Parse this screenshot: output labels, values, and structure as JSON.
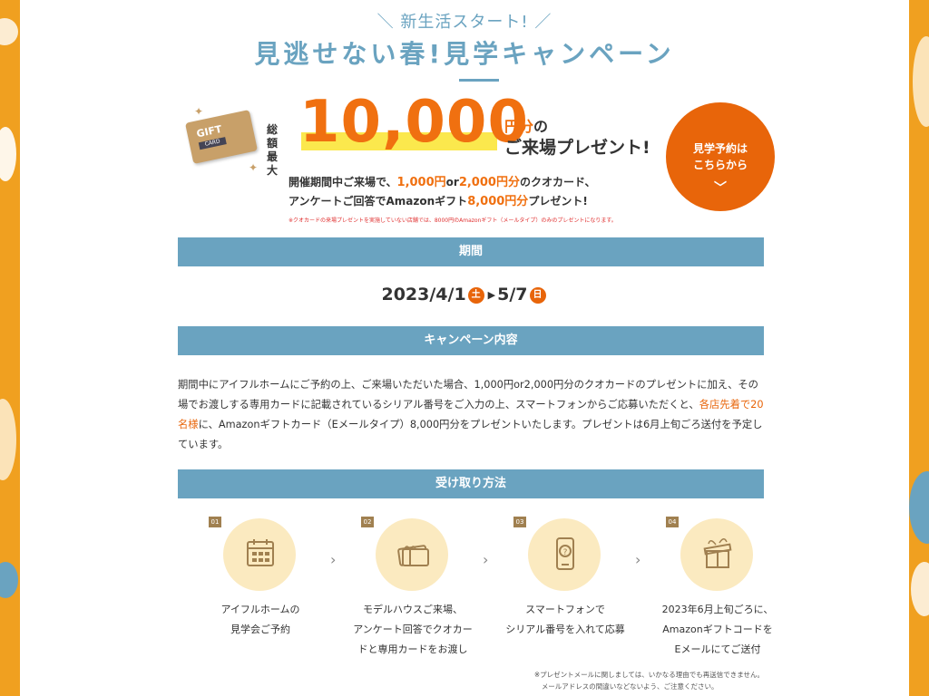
{
  "header": {
    "kicker": "＼ 新生活スタート! ／",
    "title": "見逃せない春!見学キャンペーン"
  },
  "gift_card": {
    "line1": "GIFT",
    "line2": "CARD"
  },
  "offer": {
    "total_label": "総額最大",
    "amount": "10,000",
    "yen_unit": "円分",
    "yen_suffix": "の",
    "present_text": "ご来場プレゼント!",
    "sub1_a": "開催期間中ご来場で、",
    "sub1_b": "1,000円",
    "sub1_c": "or",
    "sub1_d": "2,000円分",
    "sub1_e": "のクオカード、",
    "sub2_a": "アンケートご回答でAmazonギフト",
    "sub2_b": "8,000円分",
    "sub2_c": "プレゼント!",
    "note": "※クオカードの来場プレゼントを実施していない店舗では、8000円のAmazonギフト（メールタイプ）のみのプレゼントになります。"
  },
  "cta": {
    "line1": "見学予約は",
    "line2": "こちらから",
    "chevron": "﹀"
  },
  "period": {
    "heading": "期間",
    "start": "2023/4/1",
    "start_day": "土",
    "arrow": "▶",
    "end": "5/7",
    "end_day": "日"
  },
  "campaign": {
    "heading": "キャンペーン内容",
    "text_a": "期間中にアイフルホームにご予約の上、ご来場いただいた場合、1,000円or2,000円分のクオカードのプレゼントに加え、その場でお渡しする専用カードに記載されているシリアル番号をご入力の上、スマートフォンからご応募いただくと、",
    "text_b": "各店先着で20名様",
    "text_c": "に、Amazonギフトカード（Eメールタイプ）8,000円分をプレゼントいたします。プレゼントは6月上旬ごろ送付を予定しています。"
  },
  "receive": {
    "heading": "受け取り方法",
    "steps": [
      {
        "num": "01",
        "icon": "calendar-icon",
        "line1": "アイフルホームの",
        "line2": "見学会ご予約",
        "line3": ""
      },
      {
        "num": "02",
        "icon": "gift-card-icon",
        "line1": "モデルハウスご来場、",
        "line2": "アンケート回答でクオカー",
        "line3": "ドと専用カードをお渡し"
      },
      {
        "num": "03",
        "icon": "smartphone-icon",
        "line1": "スマートフォンで",
        "line2": "シリアル番号を入れて応募",
        "line3": ""
      },
      {
        "num": "04",
        "icon": "present-box-icon",
        "line1": "2023年6月上旬ごろに、",
        "line2": "Amazonギフトコードを",
        "line3": "Eメールにてご送付"
      }
    ],
    "separator": "›"
  },
  "footnote": {
    "line1": "※プレゼントメールに関しましては、いかなる理由でも再送信できません。",
    "line2": "メールアドレスの間違いなどないよう、ご注意ください。"
  },
  "colors": {
    "accent_blue": "#6aa3c0",
    "accent_orange": "#e8650a",
    "highlight_yellow": "#fbe84d",
    "side_orange": "#f0a020"
  }
}
